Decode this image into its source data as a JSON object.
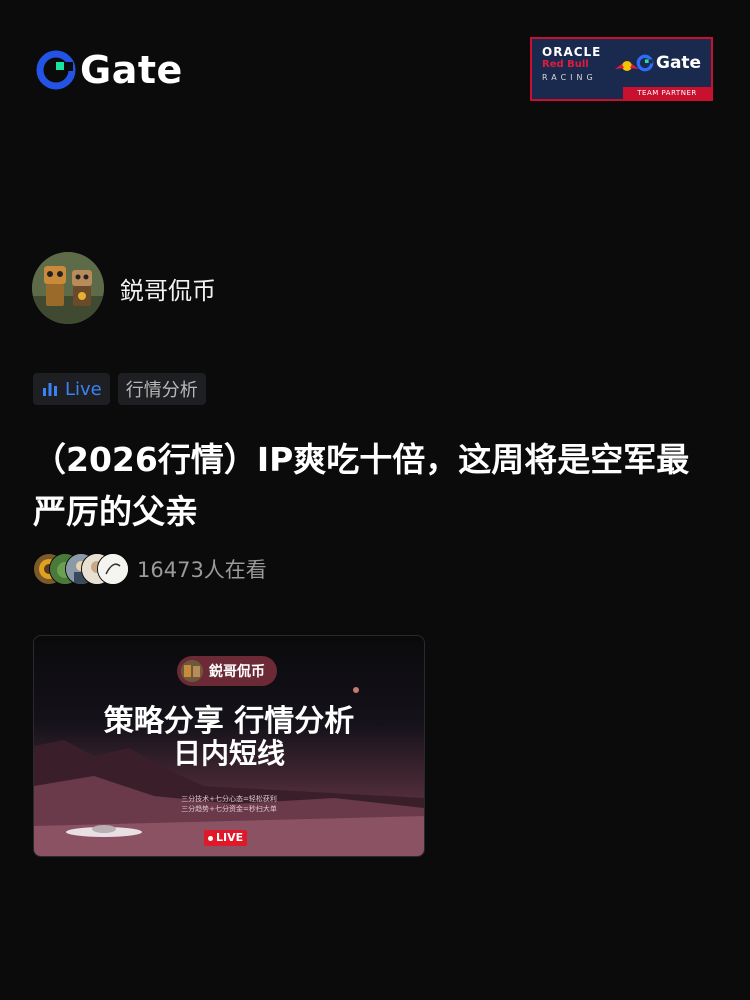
{
  "brand": {
    "name": "Gate"
  },
  "partner": {
    "oracle": "ORACLE",
    "redbull": "Red Bull",
    "racing": "RACING",
    "gate": "Gate",
    "team_partner": "TEAM PARTNER"
  },
  "author": {
    "name": "鋭哥侃币"
  },
  "tags": {
    "live": "Live",
    "category": "行情分析"
  },
  "post": {
    "title": "（2026行情）IP爽吃十倍，这周将是空军最严厉的父亲",
    "viewers": "16473人在看"
  },
  "thumbnail": {
    "chip": "鋭哥侃币",
    "headline1": "策略分享 行情分析",
    "headline2": "日内短线",
    "sub1": "三分技术+七分心态=轻松获利",
    "sub2": "三分趋势+七分资金=秒扫大单",
    "live": "LIVE"
  },
  "colors": {
    "accent": "#3b82f6",
    "gate_green": "#17e5a0",
    "gate_blue": "#2354e6",
    "live_red": "#e0192a"
  }
}
